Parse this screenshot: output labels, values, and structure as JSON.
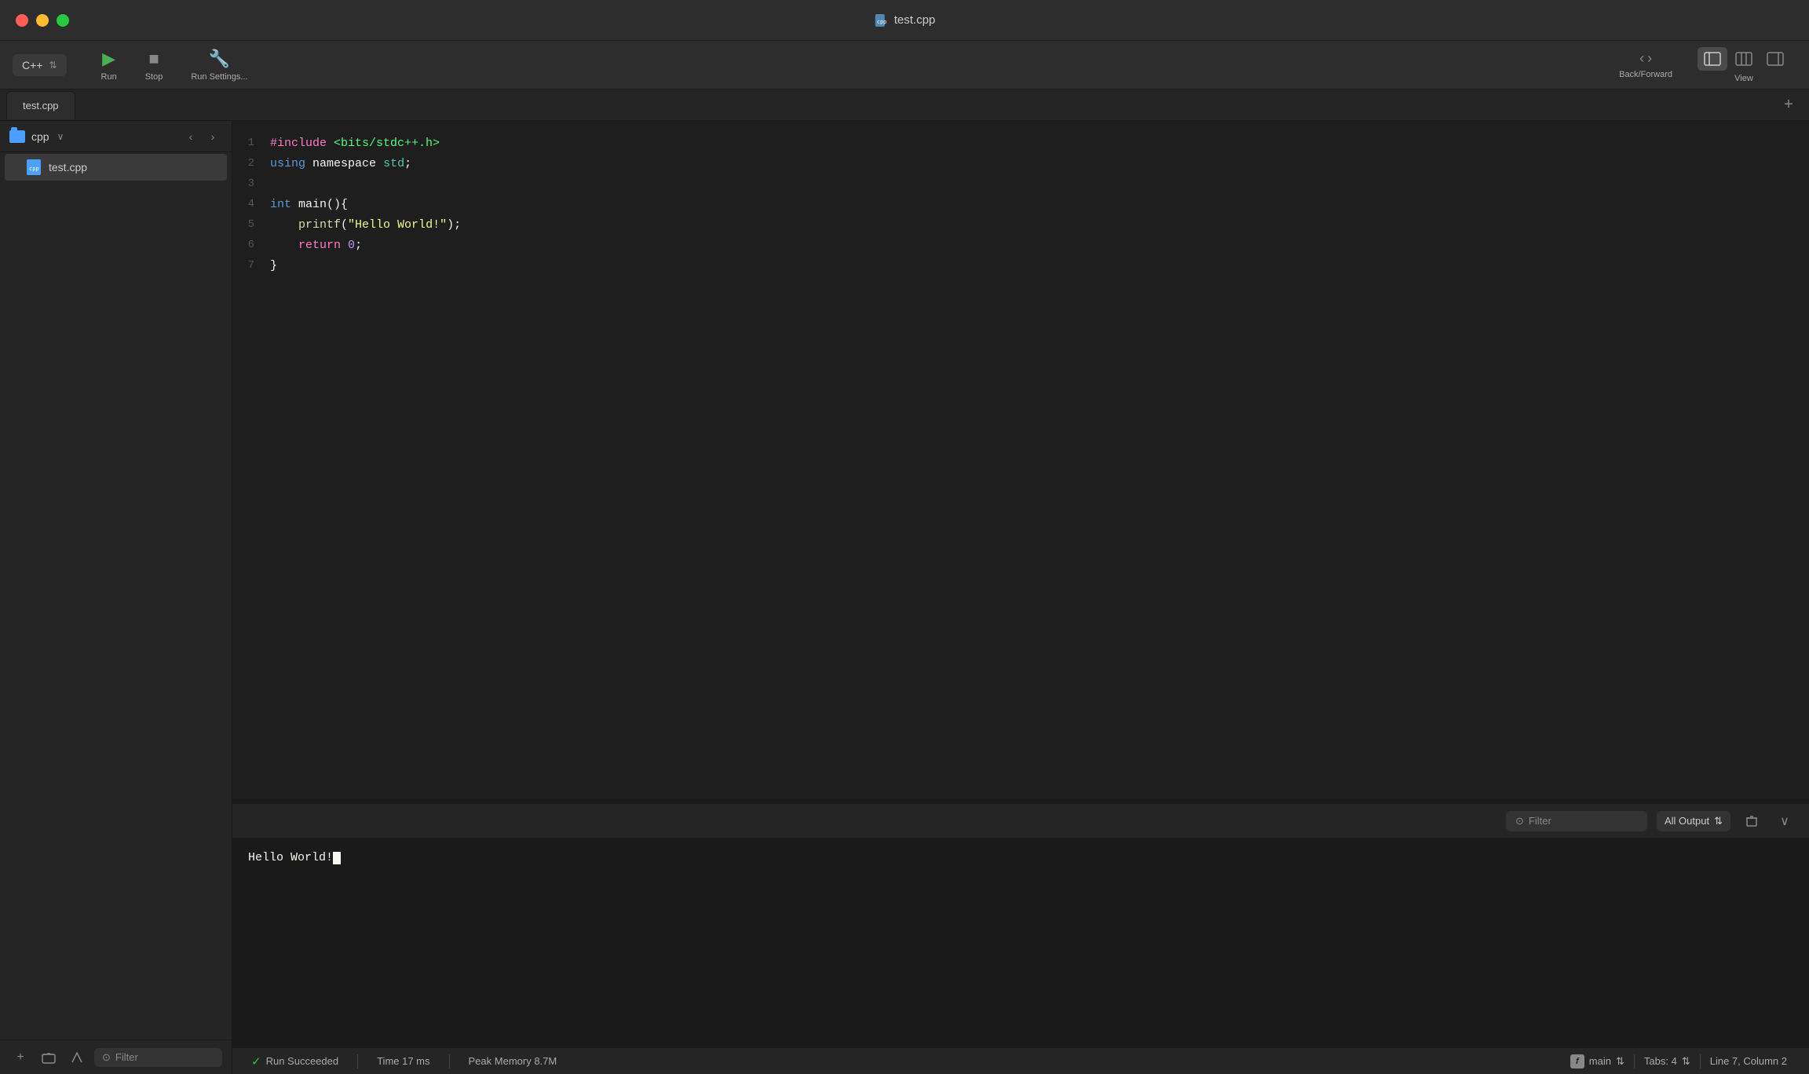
{
  "window": {
    "title": "test.cpp"
  },
  "titlebar": {
    "title": "test.cpp",
    "traffic_lights": [
      "red",
      "yellow",
      "green"
    ]
  },
  "toolbar": {
    "language": "C++",
    "run_label": "Run",
    "stop_label": "Stop",
    "settings_label": "Run Settings...",
    "back_forward_label": "Back/Forward",
    "view_label": "View"
  },
  "tab": {
    "name": "test.cpp",
    "add_label": "+"
  },
  "sidebar": {
    "folder_name": "cpp",
    "file_name": "test.cpp",
    "filter_placeholder": "Filter",
    "add_label": "+",
    "folder_label": "📁"
  },
  "editor": {
    "lines": [
      {
        "num": "1",
        "raw": "#include <bits/stdc++.h>"
      },
      {
        "num": "2",
        "raw": "using namespace std;"
      },
      {
        "num": "3",
        "raw": ""
      },
      {
        "num": "4",
        "raw": "int main(){"
      },
      {
        "num": "5",
        "raw": "    printf(\"Hello World!\");"
      },
      {
        "num": "6",
        "raw": "    return 0;"
      },
      {
        "num": "7",
        "raw": "}"
      }
    ]
  },
  "output": {
    "filter_placeholder": "Filter",
    "dropdown_label": "All Output",
    "content": "Hello World!"
  },
  "statusbar": {
    "run_status": "Run Succeeded",
    "time": "Time 17 ms",
    "memory": "Peak Memory 8.7M",
    "function": "main",
    "tabs": "Tabs: 4",
    "position": "Line 7, Column 2"
  }
}
